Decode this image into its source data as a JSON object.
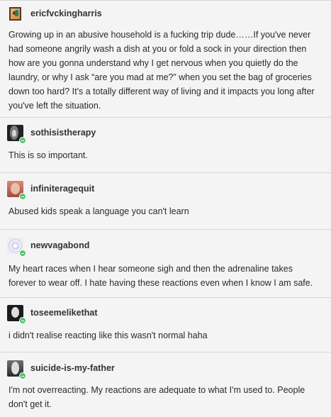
{
  "posts": [
    {
      "username": "ericfvckingharris",
      "text": "Growing up in an abusive household is a fucking trip dude……If you've never had someone angrily wash a dish at you or fold a sock in your direction then how are you gonna understand why I get nervous when you quietly do the laundry, or why I ask “are you mad at me?” when you set the bag of groceries down too hard? It's a totally different way of living and it impacts you long after you've left the situation."
    },
    {
      "username": "sothisistherapy",
      "text": "This is so important."
    },
    {
      "username": "infiniteragequit",
      "text": "Abused kids speak a language you can't learn"
    },
    {
      "username": "newvagabond",
      "text": "My heart races when I hear someone sigh and then the adrenaline takes forever to wear off. I hate having these reactions even when I know I am safe."
    },
    {
      "username": "toseemelikethat",
      "text": "i didn't realise reacting like this wasn't normal haha"
    },
    {
      "username": "suicide-is-my-father",
      "text": "I'm not overreacting. My reactions are adequate to what I'm used to. People don't get it."
    }
  ]
}
